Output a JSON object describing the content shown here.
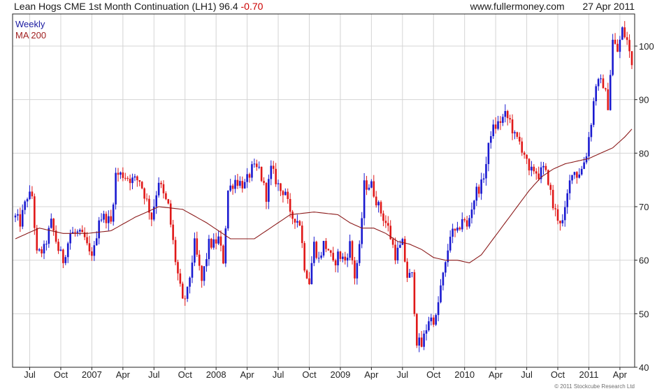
{
  "header": {
    "title": "Lean Hogs CME 1st Month Continuation (LH1)",
    "last": "96.4",
    "change": "-0.70",
    "site": "www.fullermoney.com",
    "date": "27 Apr 2011"
  },
  "footer": {
    "copyright": "© 2011 Stockcube Research Ltd"
  },
  "colors": {
    "up": "#1a1ad0",
    "down": "#e01818",
    "ma": "#8b1a1a",
    "grid": "#d4d4d4"
  },
  "chart_data": {
    "type": "candlestick",
    "frequency": "Weekly",
    "series": [
      {
        "name": "Weekly",
        "style": "ohlc-bars"
      },
      {
        "name": "MA 200",
        "style": "line"
      }
    ],
    "ylim": [
      40,
      106
    ],
    "yticks": [
      40,
      50,
      60,
      70,
      80,
      90,
      100
    ],
    "xticks": [
      "Jul",
      "Oct",
      "2007",
      "Apr",
      "Jul",
      "Oct",
      "2008",
      "Apr",
      "Jul",
      "Oct",
      "2009",
      "Apr",
      "Jul",
      "Oct",
      "2010",
      "Apr",
      "Jul",
      "Oct",
      "2011",
      "Apr"
    ],
    "xtick_weeks": [
      6,
      19,
      32,
      45,
      58,
      71,
      84,
      97,
      110,
      123,
      136,
      149,
      162,
      175,
      188,
      201,
      214,
      227,
      240,
      253
    ],
    "week_count": 258,
    "close_keypoints": [
      [
        0,
        68
      ],
      [
        2,
        67
      ],
      [
        5,
        72
      ],
      [
        7,
        72
      ],
      [
        9,
        61
      ],
      [
        12,
        62
      ],
      [
        15,
        67
      ],
      [
        18,
        62
      ],
      [
        20,
        60
      ],
      [
        23,
        65
      ],
      [
        26,
        65
      ],
      [
        29,
        64
      ],
      [
        31,
        61
      ],
      [
        33,
        62
      ],
      [
        35,
        68
      ],
      [
        38,
        68
      ],
      [
        40,
        67
      ],
      [
        42,
        76
      ],
      [
        45,
        76
      ],
      [
        49,
        75
      ],
      [
        52,
        75
      ],
      [
        55,
        71
      ],
      [
        57,
        68
      ],
      [
        60,
        75
      ],
      [
        62,
        72
      ],
      [
        64,
        70
      ],
      [
        67,
        60
      ],
      [
        70,
        52
      ],
      [
        72,
        54
      ],
      [
        75,
        63
      ],
      [
        78,
        56
      ],
      [
        81,
        63
      ],
      [
        83,
        63
      ],
      [
        85,
        64
      ],
      [
        87,
        60
      ],
      [
        89,
        73
      ],
      [
        92,
        75
      ],
      [
        96,
        74
      ],
      [
        99,
        77
      ],
      [
        102,
        77
      ],
      [
        105,
        72
      ],
      [
        107,
        77
      ],
      [
        109,
        75
      ],
      [
        111,
        73
      ],
      [
        113,
        73
      ],
      [
        115,
        68
      ],
      [
        117,
        68
      ],
      [
        119,
        67
      ],
      [
        121,
        59
      ],
      [
        123,
        56
      ],
      [
        125,
        63
      ],
      [
        127,
        60
      ],
      [
        129,
        63
      ],
      [
        131,
        62
      ],
      [
        133,
        59
      ],
      [
        135,
        61
      ],
      [
        138,
        60
      ],
      [
        140,
        63
      ],
      [
        142,
        57
      ],
      [
        144,
        62
      ],
      [
        146,
        74
      ],
      [
        149,
        74
      ],
      [
        152,
        70
      ],
      [
        154,
        68
      ],
      [
        156,
        66
      ],
      [
        159,
        61
      ],
      [
        162,
        63
      ],
      [
        164,
        57
      ],
      [
        166,
        57
      ],
      [
        168,
        45
      ],
      [
        170,
        44
      ],
      [
        173,
        49
      ],
      [
        176,
        49
      ],
      [
        178,
        55
      ],
      [
        180,
        59
      ],
      [
        182,
        65
      ],
      [
        185,
        65
      ],
      [
        187,
        68
      ],
      [
        189,
        66
      ],
      [
        191,
        70
      ],
      [
        193,
        73
      ],
      [
        195,
        74
      ],
      [
        197,
        78
      ],
      [
        199,
        84
      ],
      [
        201,
        85
      ],
      [
        203,
        86
      ],
      [
        205,
        87
      ],
      [
        207,
        86
      ],
      [
        209,
        83
      ],
      [
        211,
        82
      ],
      [
        213,
        80
      ],
      [
        215,
        76
      ],
      [
        217,
        77
      ],
      [
        219,
        76
      ],
      [
        221,
        77
      ],
      [
        223,
        75
      ],
      [
        225,
        70
      ],
      [
        227,
        68
      ],
      [
        229,
        67
      ],
      [
        230,
        69
      ],
      [
        231,
        72
      ],
      [
        233,
        77
      ],
      [
        235,
        76
      ],
      [
        237,
        77
      ],
      [
        239,
        80
      ],
      [
        241,
        86
      ],
      [
        243,
        93
      ],
      [
        246,
        93
      ],
      [
        248,
        89
      ],
      [
        250,
        101
      ],
      [
        252,
        99
      ],
      [
        254,
        103
      ],
      [
        256,
        101
      ],
      [
        258,
        96.4
      ]
    ],
    "ma_keypoints": [
      [
        0,
        64
      ],
      [
        10,
        66
      ],
      [
        20,
        65
      ],
      [
        30,
        65
      ],
      [
        40,
        65.5
      ],
      [
        50,
        68
      ],
      [
        60,
        70
      ],
      [
        70,
        69.5
      ],
      [
        80,
        67
      ],
      [
        90,
        64
      ],
      [
        100,
        64
      ],
      [
        110,
        67
      ],
      [
        115,
        68.5
      ],
      [
        125,
        69
      ],
      [
        135,
        68.5
      ],
      [
        140,
        67
      ],
      [
        145,
        66
      ],
      [
        150,
        66
      ],
      [
        155,
        65
      ],
      [
        160,
        63.5
      ],
      [
        165,
        63
      ],
      [
        170,
        62
      ],
      [
        175,
        60.5
      ],
      [
        180,
        60
      ],
      [
        185,
        60
      ],
      [
        190,
        59.5
      ],
      [
        195,
        61
      ],
      [
        200,
        64
      ],
      [
        205,
        67
      ],
      [
        210,
        70
      ],
      [
        215,
        73
      ],
      [
        220,
        75.5
      ],
      [
        225,
        77
      ],
      [
        230,
        78
      ],
      [
        235,
        78.5
      ],
      [
        240,
        79
      ],
      [
        245,
        80
      ],
      [
        250,
        81
      ],
      [
        255,
        83
      ],
      [
        258,
        84.5
      ]
    ]
  }
}
